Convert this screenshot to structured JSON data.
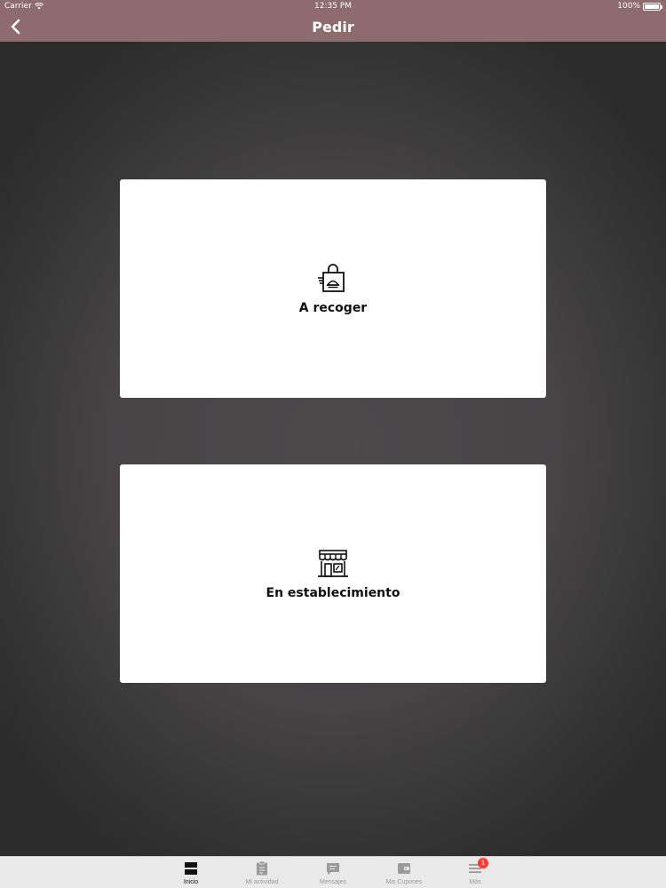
{
  "status_bar": {
    "carrier": "Carrier",
    "time": "12:35 PM",
    "battery": "100%"
  },
  "nav": {
    "title": "Pedir",
    "back_icon": "chevron-left-icon"
  },
  "options": [
    {
      "label": "A recoger",
      "icon": "shopping-bag-icon"
    },
    {
      "label": "En establecimiento",
      "icon": "storefront-icon"
    }
  ],
  "tabs": [
    {
      "label": "Inicio",
      "icon": "home-icon",
      "active": true
    },
    {
      "label": "Mi actividad",
      "icon": "clipboard-icon",
      "active": false
    },
    {
      "label": "Mensajes",
      "icon": "chat-icon",
      "active": false
    },
    {
      "label": "Mis Cupones",
      "icon": "wallet-icon",
      "active": false
    },
    {
      "label": "Más",
      "icon": "menu-icon",
      "active": false,
      "badge": "1"
    }
  ],
  "colors": {
    "header": "#8e6b6e",
    "background": "#3a3a3a",
    "card": "#ffffff",
    "badge": "#ff3b30"
  }
}
